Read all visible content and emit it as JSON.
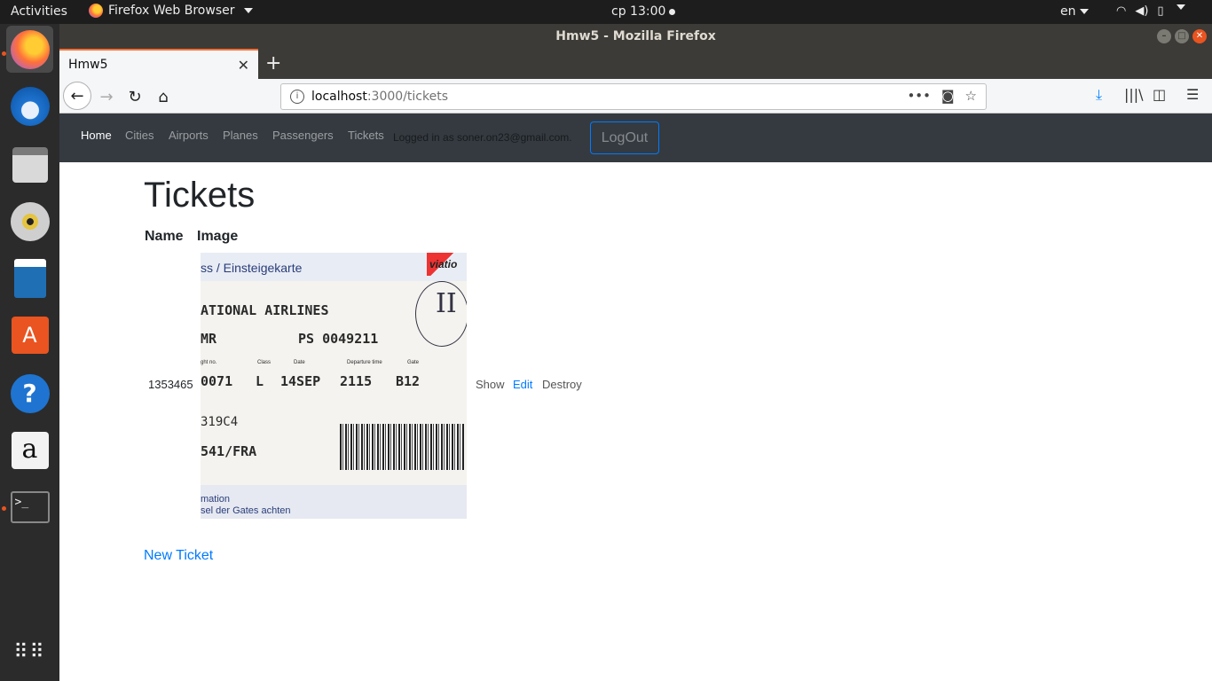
{
  "system": {
    "activities": "Activities",
    "app_menu": "Firefox Web Browser",
    "clock": "ср 13:00",
    "language": "en"
  },
  "window": {
    "title": "Hmw5 - Mozilla Firefox"
  },
  "browser": {
    "tab_title": "Hmw5",
    "url_host": "localhost",
    "url_path": ":3000/tickets"
  },
  "site_nav": {
    "links": [
      "Home",
      "Cities",
      "Airports",
      "Planes",
      "Passengers",
      "Tickets"
    ],
    "logged_in": "Logged in as soner.on23@gmail.com.",
    "logout": "LogOut"
  },
  "main": {
    "heading": "Tickets",
    "columns": [
      "Name",
      "Image"
    ],
    "rows": [
      {
        "name": "1353465",
        "image_text": {
          "header": "ss / Einsteigekarte",
          "airline": "ATIONAL AIRLINES",
          "passenger": "MR",
          "pnr": "PS 0049211",
          "flight_labels": "ght no.",
          "class_label": "Class",
          "date_label": "Date",
          "dep_label": "Departure time",
          "gate_label": "Gate",
          "flight": "0071",
          "class": "L",
          "date": "14SEP",
          "time": "2115",
          "gate": "B12",
          "code": "319C4",
          "route": "541/FRA",
          "footer1": "mation",
          "footer2": "sel der Gates achten",
          "logo": "viatio",
          "stamp": "II"
        },
        "actions": [
          "Show",
          "Edit",
          "Destroy"
        ]
      }
    ],
    "new_link": "New Ticket"
  },
  "colors": {
    "accent": "#007bff",
    "navbar_bg": "#343a40",
    "ubuntu_orange": "#e95420"
  }
}
